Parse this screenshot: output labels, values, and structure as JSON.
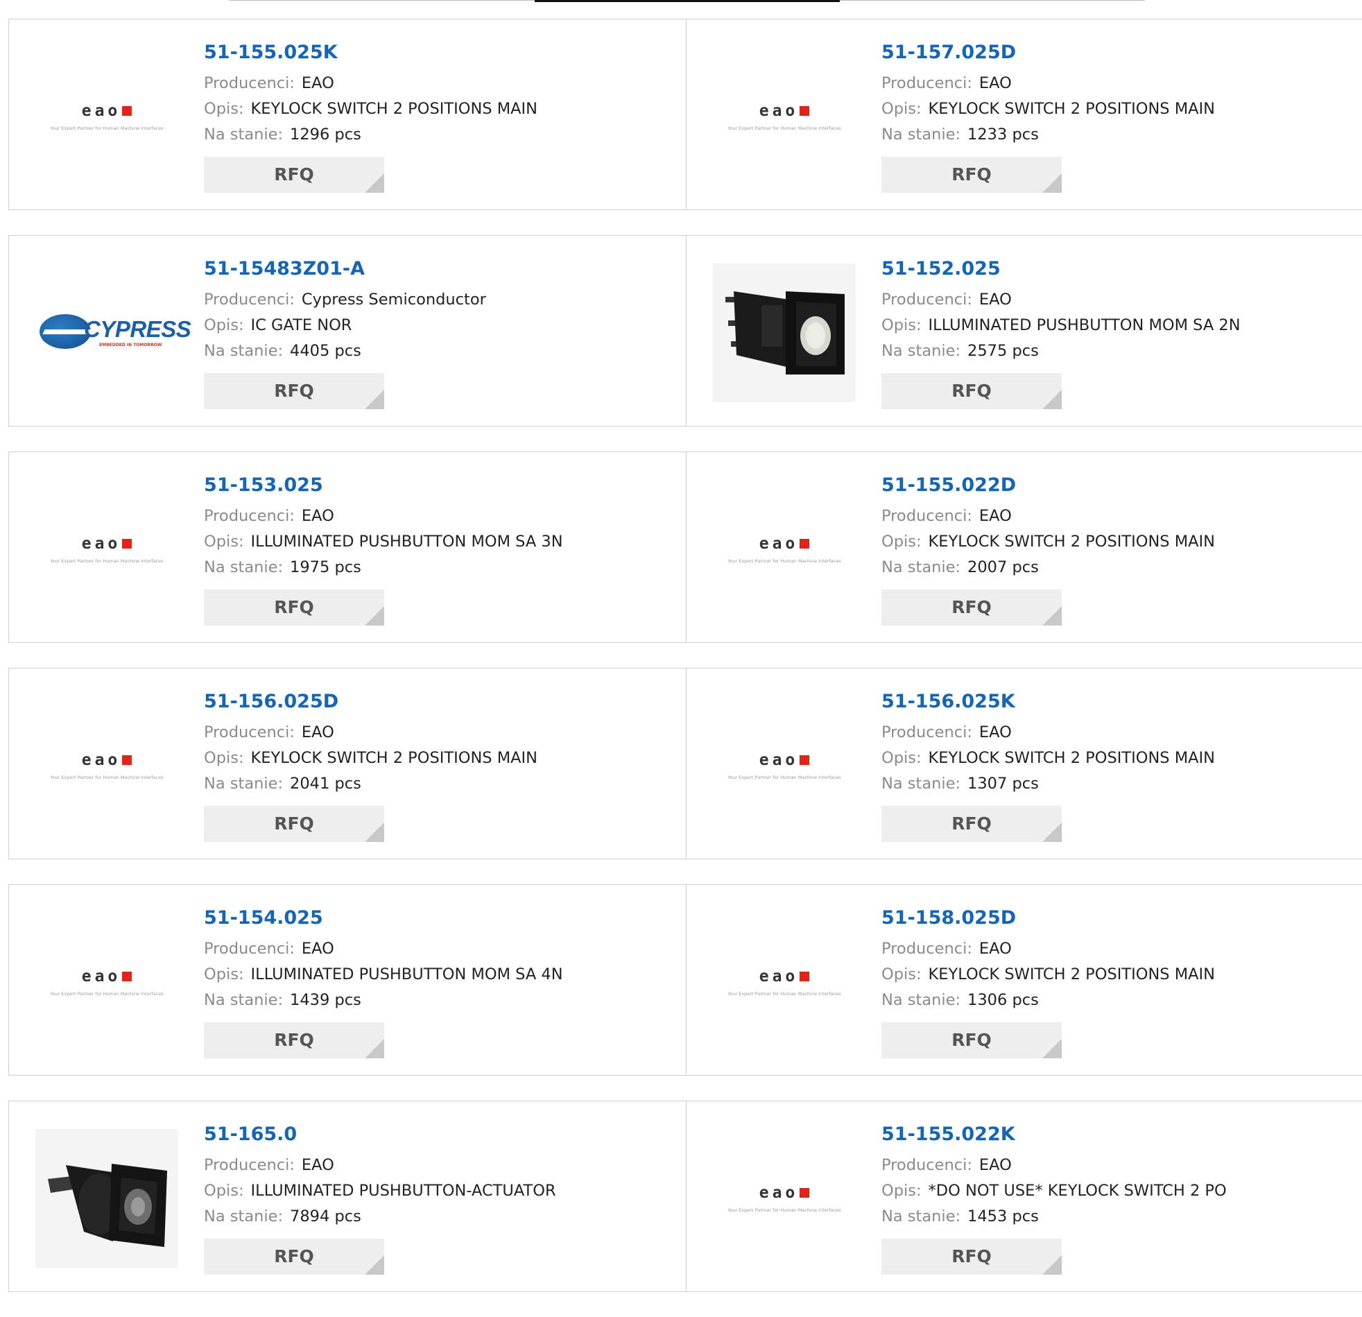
{
  "labels": {
    "manufacturer": "Producenci:",
    "description": "Opis:",
    "stock": "Na stanie:",
    "rfq": "RFQ"
  },
  "logos": {
    "eao_word": "eao",
    "eao_tagline": "Your Expert Partner for Human Machine Interfaces",
    "cypress_word": "CYPRESS",
    "cypress_tagline": "EMBEDDED IN TOMORROW"
  },
  "products": [
    {
      "part": "51-155.025K",
      "manufacturer": "EAO",
      "description": "KEYLOCK SWITCH 2 POSITIONS MAIN",
      "stock": "1296 pcs",
      "image": "eao-logo"
    },
    {
      "part": "51-157.025D",
      "manufacturer": "EAO",
      "description": "KEYLOCK SWITCH 2 POSITIONS MAIN",
      "stock": "1233 pcs",
      "image": "eao-logo"
    },
    {
      "part": "51-15483Z01-A",
      "manufacturer": "Cypress Semiconductor",
      "description": "IC GATE NOR",
      "stock": "4405 pcs",
      "image": "cypress-logo"
    },
    {
      "part": "51-152.025",
      "manufacturer": "EAO",
      "description": "ILLUMINATED PUSHBUTTON MOM SA 2N",
      "stock": "2575 pcs",
      "image": "pushbutton-photo"
    },
    {
      "part": "51-153.025",
      "manufacturer": "EAO",
      "description": "ILLUMINATED PUSHBUTTON MOM SA 3N",
      "stock": "1975 pcs",
      "image": "eao-logo"
    },
    {
      "part": "51-155.022D",
      "manufacturer": "EAO",
      "description": "KEYLOCK SWITCH 2 POSITIONS MAIN",
      "stock": "2007 pcs",
      "image": "eao-logo"
    },
    {
      "part": "51-156.025D",
      "manufacturer": "EAO",
      "description": "KEYLOCK SWITCH 2 POSITIONS MAIN",
      "stock": "2041 pcs",
      "image": "eao-logo"
    },
    {
      "part": "51-156.025K",
      "manufacturer": "EAO",
      "description": "KEYLOCK SWITCH 2 POSITIONS MAIN",
      "stock": "1307 pcs",
      "image": "eao-logo"
    },
    {
      "part": "51-154.025",
      "manufacturer": "EAO",
      "description": "ILLUMINATED PUSHBUTTON MOM SA 4N",
      "stock": "1439 pcs",
      "image": "eao-logo"
    },
    {
      "part": "51-158.025D",
      "manufacturer": "EAO",
      "description": "KEYLOCK SWITCH 2 POSITIONS MAIN",
      "stock": "1306 pcs",
      "image": "eao-logo"
    },
    {
      "part": "51-165.0",
      "manufacturer": "EAO",
      "description": "ILLUMINATED PUSHBUTTON-ACTUATOR",
      "stock": "7894 pcs",
      "image": "actuator-photo"
    },
    {
      "part": "51-155.022K",
      "manufacturer": "EAO",
      "description": "*DO NOT USE* KEYLOCK SWITCH 2 PO",
      "stock": "1453 pcs",
      "image": "eao-logo"
    }
  ],
  "colors": {
    "link": "#1565b5",
    "label": "#8a8a8a",
    "border": "#cfcfcf",
    "button_bg": "#eeeeee",
    "eao_red": "#e2231a",
    "cypress_blue": "#1d5ea8"
  }
}
